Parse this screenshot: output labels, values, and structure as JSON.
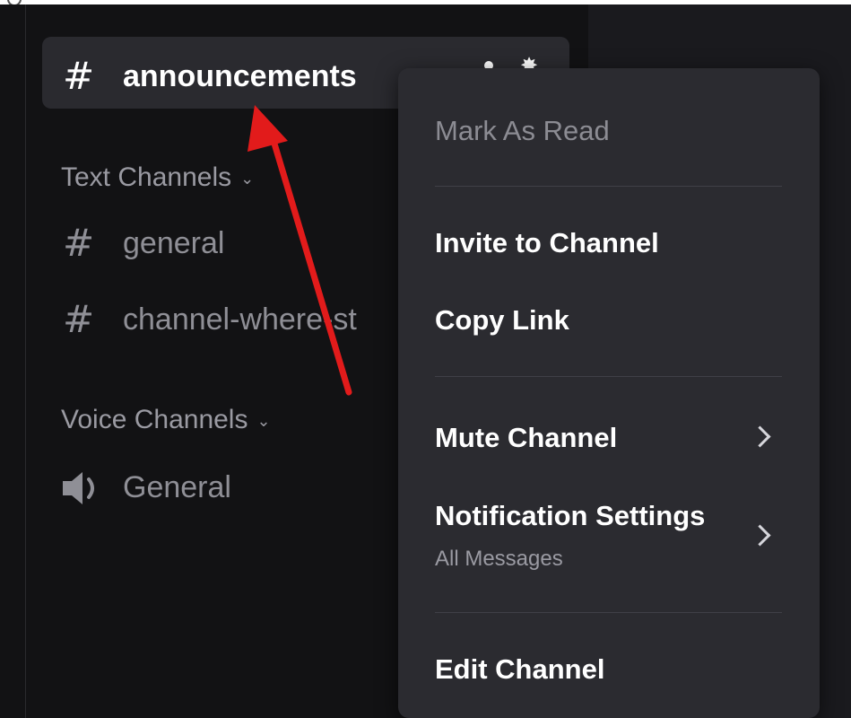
{
  "sidebar": {
    "active_channel": {
      "name": "announcements",
      "icon": "hash-icon"
    },
    "categories": [
      {
        "label": "Text Channels"
      },
      {
        "label": "Voice Channels"
      }
    ],
    "text_channels": [
      {
        "name": "general",
        "icon": "hash-icon"
      },
      {
        "name": "channel-where-st",
        "icon": "hash-icon"
      }
    ],
    "voice_channels": [
      {
        "name": "General",
        "icon": "speaker-icon"
      }
    ]
  },
  "context_menu": {
    "mark_as_read": "Mark As Read",
    "invite": "Invite to Channel",
    "copy_link": "Copy Link",
    "mute": "Mute Channel",
    "notification_settings": "Notification Settings",
    "notification_sub": "All Messages",
    "edit": "Edit Channel"
  },
  "colors": {
    "accent_arrow": "#e21b1b",
    "background": "#121214",
    "menu_bg": "#2b2b30"
  }
}
